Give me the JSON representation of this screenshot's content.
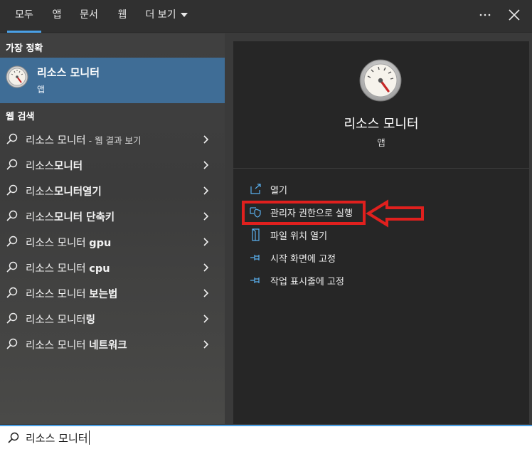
{
  "tabs": [
    {
      "label": "모두",
      "active": true
    },
    {
      "label": "앱",
      "active": false
    },
    {
      "label": "문서",
      "active": false
    },
    {
      "label": "웹",
      "active": false
    },
    {
      "label": "더 보기",
      "active": false
    }
  ],
  "top_icons": {
    "more": "ellipsis-icon",
    "close": "close-icon"
  },
  "best_match": {
    "section_label": "가장 정확",
    "title": "리소스 모니터",
    "subtitle": "앱",
    "icon": "resource-monitor-gauge-icon"
  },
  "web_search": {
    "section_label": "웹 검색",
    "items": [
      {
        "normal": "리소스 모니터",
        "bold": "",
        "suffix": " - 웹 결과 보기"
      },
      {
        "normal": "리소스",
        "bold": "모니터",
        "suffix": ""
      },
      {
        "normal": "리소스",
        "bold": "모니터열기",
        "suffix": ""
      },
      {
        "normal": "리소스",
        "bold": "모니터 단축키",
        "suffix": ""
      },
      {
        "normal": "리소스 모니터 ",
        "bold": "gpu",
        "suffix": ""
      },
      {
        "normal": "리소스 모니터 ",
        "bold": "cpu",
        "suffix": ""
      },
      {
        "normal": "리소스 모니터 ",
        "bold": "보는법",
        "suffix": ""
      },
      {
        "normal": "리소스 모니터",
        "bold": "링",
        "suffix": ""
      },
      {
        "normal": "리소스 모니터 ",
        "bold": "네트워크",
        "suffix": ""
      }
    ]
  },
  "detail": {
    "app_name": "리소스 모니터",
    "app_type": "앱",
    "actions": [
      {
        "label": "열기",
        "icon": "open-icon"
      },
      {
        "label": "관리자 권한으로 실행",
        "icon": "shield-icon",
        "highlighted": true
      },
      {
        "label": "파일 위치 열기",
        "icon": "file-location-icon"
      },
      {
        "label": "시작 화면에 고정",
        "icon": "pin-icon"
      },
      {
        "label": "작업 표시줄에 고정",
        "icon": "pin-icon"
      }
    ]
  },
  "search": {
    "query": "리소스 모니터"
  },
  "colors": {
    "accent": "#4aa0e6",
    "selected": "#3f6d96",
    "annotation": "#e0201e"
  }
}
